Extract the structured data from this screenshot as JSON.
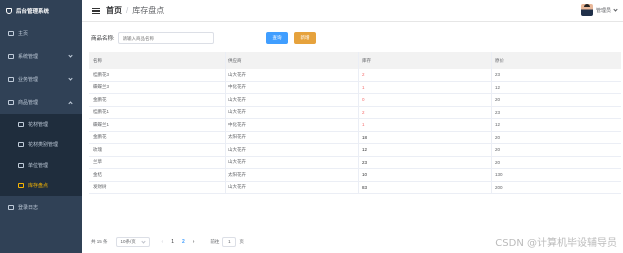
{
  "sidebar": {
    "brand": "后台管理系统",
    "items": [
      {
        "label": "主页"
      },
      {
        "label": "系统管理"
      },
      {
        "label": "业务管理"
      },
      {
        "label": "商品管理"
      }
    ],
    "sub_items": [
      {
        "label": "花材管理"
      },
      {
        "label": "花材类别管理"
      },
      {
        "label": "单位管理"
      },
      {
        "label": "库存盘点"
      }
    ],
    "login_log": "登录日志"
  },
  "header": {
    "home": "首页",
    "sep": "/",
    "current": "库存盘点",
    "user": "管理员"
  },
  "search": {
    "label": "商品名称:",
    "placeholder": "请输入商品名称",
    "query_label": "查询",
    "add_label": "新增"
  },
  "table": {
    "headers": [
      "名称",
      "供应商",
      "库存",
      "原价"
    ],
    "rows": [
      {
        "name": "桂鹏花3",
        "supplier": "山大花卉",
        "stock": "2",
        "price": "23",
        "low": true
      },
      {
        "name": "蝶蝶兰3",
        "supplier": "中化花卉",
        "stock": "1",
        "price": "12",
        "low": true
      },
      {
        "name": "金鹏花",
        "supplier": "山大花卉",
        "stock": "0",
        "price": "20",
        "low": true
      },
      {
        "name": "桂鹏花1",
        "supplier": "山大花卉",
        "stock": "2",
        "price": "23",
        "low": true
      },
      {
        "name": "蝶蝶兰1",
        "supplier": "中化花卉",
        "stock": "1",
        "price": "12",
        "low": true
      },
      {
        "name": "金鹏花",
        "supplier": "太阳花卉",
        "stock": "18",
        "price": "20",
        "low": false
      },
      {
        "name": "玫瑰",
        "supplier": "山大花卉",
        "stock": "12",
        "price": "20",
        "low": false
      },
      {
        "name": "兰草",
        "supplier": "山大花卉",
        "stock": "23",
        "price": "20",
        "low": false
      },
      {
        "name": "金桔",
        "supplier": "太阳花卉",
        "stock": "10",
        "price": "130",
        "low": false
      },
      {
        "name": "发财树",
        "supplier": "山大花卉",
        "stock": "83",
        "price": "200",
        "low": false
      }
    ]
  },
  "pagination": {
    "total": "共 15 条",
    "page_size": "10条/页",
    "prev": "‹",
    "pages": [
      "1",
      "2"
    ],
    "current_page": "2",
    "next": "›",
    "goto_label": "前往",
    "goto_value": "1",
    "page_unit": "页"
  },
  "watermark": "CSDN @计算机毕设辅导员",
  "colors": {
    "sidebar_bg": "#304156",
    "active": "#f7b500",
    "primary": "#409eff",
    "warning": "#e6a23c",
    "danger": "#f56c6c"
  }
}
